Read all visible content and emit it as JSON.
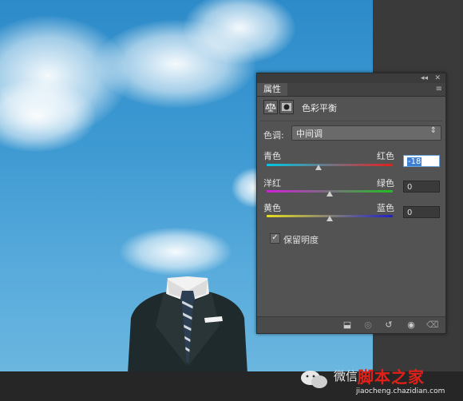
{
  "panel": {
    "tab_label": "属性",
    "collapse_icon": "double-chevron-icon",
    "close_icon": "close-icon",
    "menu_icon": "panel-menu-icon",
    "adjustment_title": "色彩平衡",
    "adjustment_icon": "balance-icon",
    "mask_icon": "mask-icon",
    "tone": {
      "label": "色调:",
      "value": "中间调"
    },
    "sliders": [
      {
        "left_label": "青色",
        "right_label": "红色",
        "value": "-18",
        "level": -18,
        "min": -100,
        "max": 100,
        "gradient": [
          "#00c8e6",
          "#e02020"
        ]
      },
      {
        "left_label": "洋红",
        "right_label": "绿色",
        "value": "0",
        "level": 0,
        "min": -100,
        "max": 100,
        "gradient": [
          "#d020d8",
          "#20c020"
        ]
      },
      {
        "left_label": "黄色",
        "right_label": "蓝色",
        "value": "0",
        "level": 0,
        "min": -100,
        "max": 100,
        "gradient": [
          "#e8e020",
          "#2020c8"
        ]
      }
    ],
    "preserve_luminosity": {
      "label": "保留明度",
      "checked": true
    },
    "footer_icons": [
      "clip-to-layer-icon",
      "view-previous-icon",
      "reset-icon",
      "visibility-icon",
      "trash-icon"
    ]
  },
  "watermark": {
    "text": "微信",
    "brand": "脚本之家",
    "url": "jiaocheng.chazidian.com"
  },
  "colors": {
    "panel_bg": "#535353",
    "sky": "#3f9ad2",
    "brand_red": "#e2201a"
  }
}
